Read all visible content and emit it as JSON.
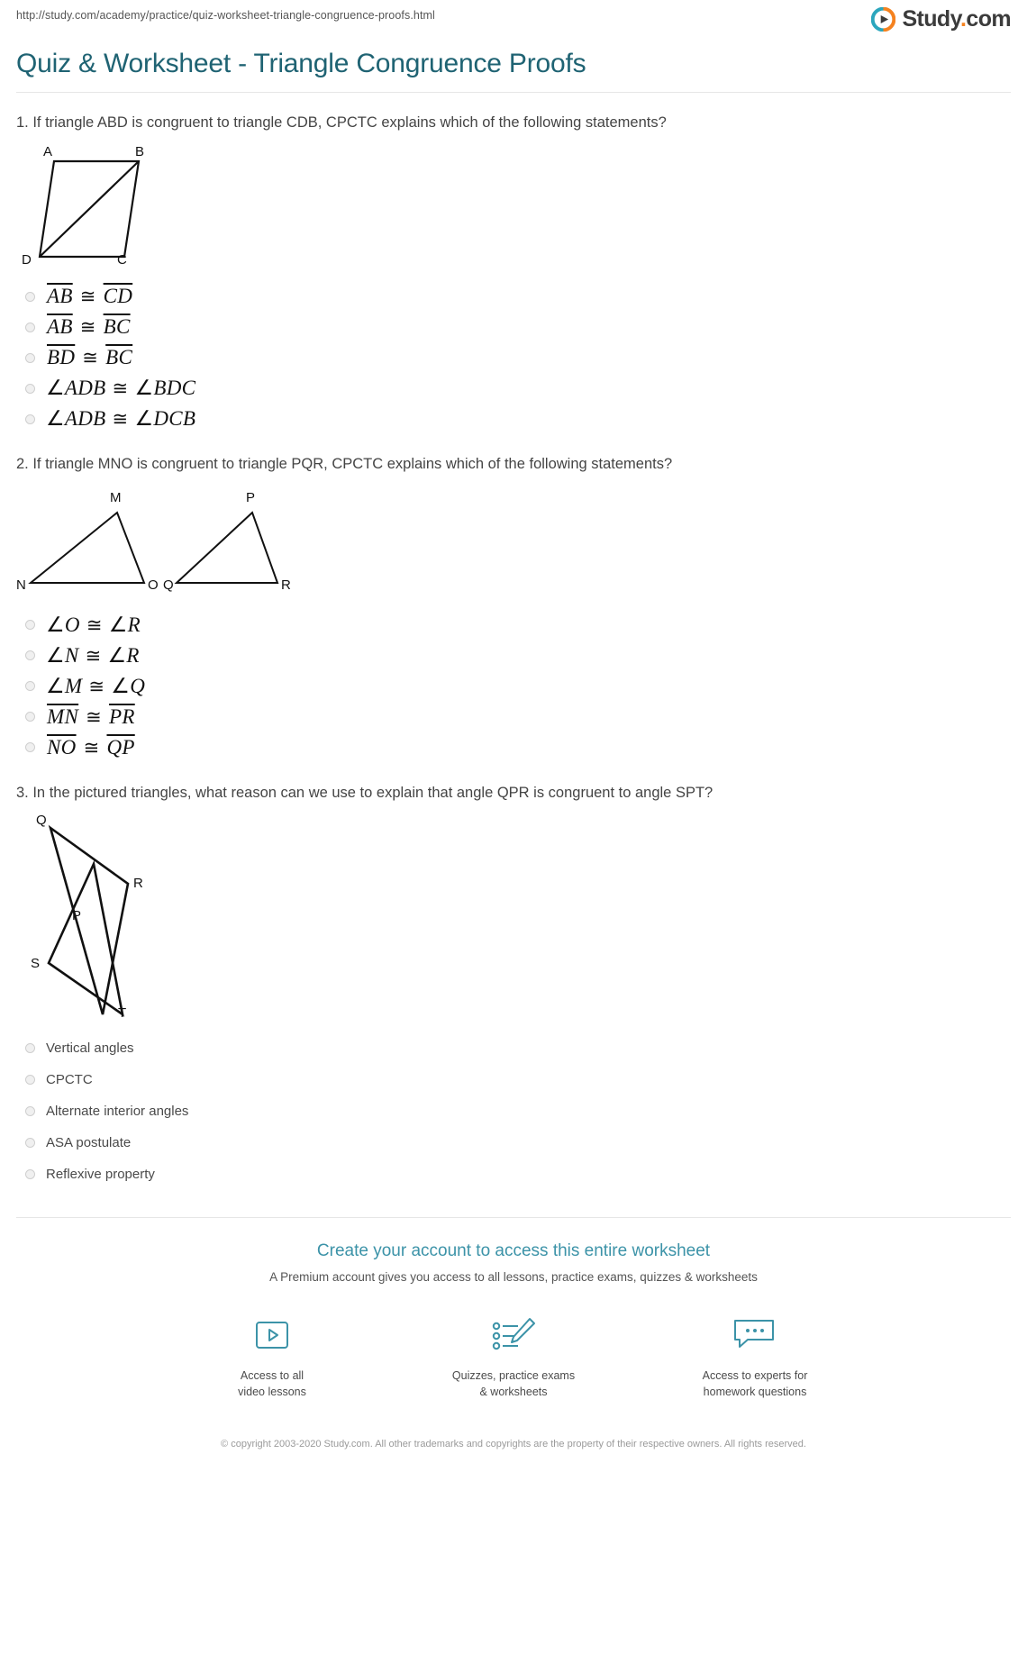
{
  "browser": {
    "url": "http://study.com/academy/practice/quiz-worksheet-triangle-congruence-proofs.html"
  },
  "brand": {
    "icon": "play-circle-icon",
    "name": "Study",
    "dot": ".",
    "tld": "com",
    "ring_teal": "#2ba6bd",
    "ring_orange": "#f5821f"
  },
  "header": {
    "title": "Quiz & Worksheet - Triangle Congruence Proofs",
    "title_color": "#1f6373"
  },
  "questions": [
    {
      "number": "1.",
      "text": "1. If triangle ABD is congruent to triangle CDB, CPCTC explains which of the following statements?",
      "figure": {
        "name": "parallelogram-abcd-with-diagonal",
        "labels": [
          "A",
          "B",
          "D",
          "C"
        ]
      },
      "options": [
        {
          "type": "segment",
          "left": "AB",
          "right": "CD",
          "relation": "≅"
        },
        {
          "type": "segment",
          "left": "AB",
          "right": "BC",
          "relation": "≅"
        },
        {
          "type": "segment",
          "left": "BD",
          "right": "BC",
          "relation": "≅"
        },
        {
          "type": "angle",
          "left": "ADB",
          "right": "BDC",
          "relation": "≅"
        },
        {
          "type": "angle",
          "left": "ADB",
          "right": "DCB",
          "relation": "≅"
        }
      ]
    },
    {
      "number": "2.",
      "text": "2. If triangle MNO is congruent to triangle PQR, CPCTC explains which of the following statements?",
      "figure": {
        "name": "two-triangles-mno-pqr",
        "labels": [
          "M",
          "N",
          "O",
          "P",
          "Q",
          "R"
        ]
      },
      "options": [
        {
          "type": "angle",
          "left": "O",
          "right": "R",
          "relation": "≅"
        },
        {
          "type": "angle",
          "left": "N",
          "right": "R",
          "relation": "≅"
        },
        {
          "type": "angle",
          "left": "M",
          "right": "Q",
          "relation": "≅"
        },
        {
          "type": "segment",
          "left": "MN",
          "right": "PR",
          "relation": "≅"
        },
        {
          "type": "segment",
          "left": "NO",
          "right": "QP",
          "relation": "≅"
        }
      ]
    },
    {
      "number": "3.",
      "text": "3. In the pictured triangles, what reason can we use to explain that angle QPR is congruent to angle SPT?",
      "figure": {
        "name": "vertical-triangles-qpr-spt",
        "labels": [
          "Q",
          "R",
          "P",
          "S",
          "T"
        ]
      },
      "options": [
        {
          "type": "plain",
          "label": "Vertical angles"
        },
        {
          "type": "plain",
          "label": "CPCTC"
        },
        {
          "type": "plain",
          "label": "Alternate interior angles"
        },
        {
          "type": "plain",
          "label": "ASA postulate"
        },
        {
          "type": "plain",
          "label": "Reflexive property"
        }
      ]
    }
  ],
  "promo": {
    "headline": "Create your account to access this entire worksheet",
    "subline": "A Premium account gives you access to all lessons, practice exams, quizzes & worksheets",
    "columns": [
      {
        "icon": "video-play-icon",
        "label": "Access to all\nvideo lessons"
      },
      {
        "icon": "quiz-checklist-pencil-icon",
        "label": "Quizzes, practice exams\n& worksheets"
      },
      {
        "icon": "chat-bubble-icon",
        "label": "Access to experts for\nhomework questions"
      }
    ],
    "accent_color": "#3c93a8"
  },
  "copyright": "© copyright 2003-2020 Study.com. All other trademarks and copyrights are the property of their respective owners. All rights reserved."
}
